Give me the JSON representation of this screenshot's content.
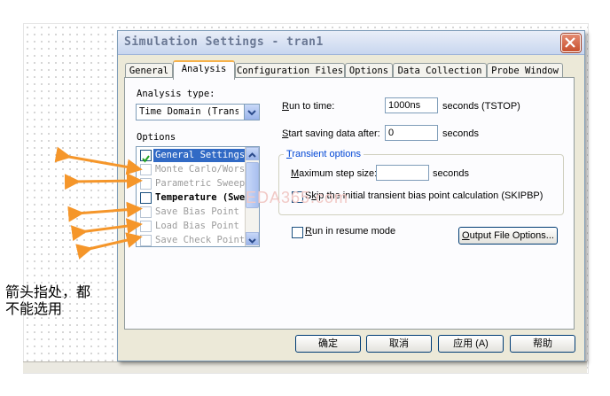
{
  "dialog": {
    "title": "Simulation Settings - tran1",
    "tabs": [
      {
        "label": "General"
      },
      {
        "label": "Analysis"
      },
      {
        "label": "Configuration Files"
      },
      {
        "label": "Options"
      },
      {
        "label": "Data Collection"
      },
      {
        "label": "Probe Window"
      }
    ],
    "active_tab": "Analysis"
  },
  "analysis": {
    "analysis_type_label": "Analysis type:",
    "analysis_type_value": "Time Domain (Transient)",
    "options_label": "Options",
    "options": [
      {
        "label": "General Settings",
        "checked": true,
        "selected": true,
        "enabled": true
      },
      {
        "label": "Monte Carlo/Worst Case",
        "checked": false,
        "selected": false,
        "enabled": false
      },
      {
        "label": "Parametric Sweep",
        "checked": false,
        "selected": false,
        "enabled": false
      },
      {
        "label": "Temperature (Sweep)",
        "checked": false,
        "selected": false,
        "enabled": true
      },
      {
        "label": "Save Bias Point",
        "checked": false,
        "selected": false,
        "enabled": false
      },
      {
        "label": "Load Bias Point",
        "checked": false,
        "selected": false,
        "enabled": false
      },
      {
        "label": "Save Check Points",
        "checked": false,
        "selected": false,
        "enabled": false
      }
    ],
    "run_to_time": {
      "label_key": "R",
      "label_rest": "un to time:",
      "value": "1000ns",
      "unit": "seconds (TSTOP)"
    },
    "start_saving": {
      "label_key": "S",
      "label_rest": "tart saving data after:",
      "value": "0",
      "unit": "seconds"
    },
    "transient_options": {
      "title_key": "T",
      "title_rest": "ransient options",
      "max_step": {
        "label_key": "M",
        "label_rest": "aximum step size:",
        "value": "",
        "unit": "seconds"
      },
      "skip_bias": {
        "label_prefix": "S",
        "label_key": "k",
        "label_rest": "ip the initial transient bias point calculation  (SKIPBP)",
        "checked": false
      }
    },
    "resume_mode": {
      "label_prefix": "",
      "label_key": "R",
      "label_rest": "un in resume mode",
      "checked": false
    },
    "output_file_options": {
      "label_key": "O",
      "label_rest": "utput File Options..."
    }
  },
  "footer_buttons": {
    "ok": "确定",
    "cancel": "取消",
    "apply": "应用 (A)",
    "help": "帮助"
  },
  "watermark": "EDA365.com",
  "annotation": {
    "line1": "箭头指处，都",
    "line2": "不能选用"
  },
  "colors": {
    "dialog_bg": "#ece9d8",
    "selection": "#316ac5",
    "arrow": "#f5962a",
    "group_title": "#0046d5"
  }
}
